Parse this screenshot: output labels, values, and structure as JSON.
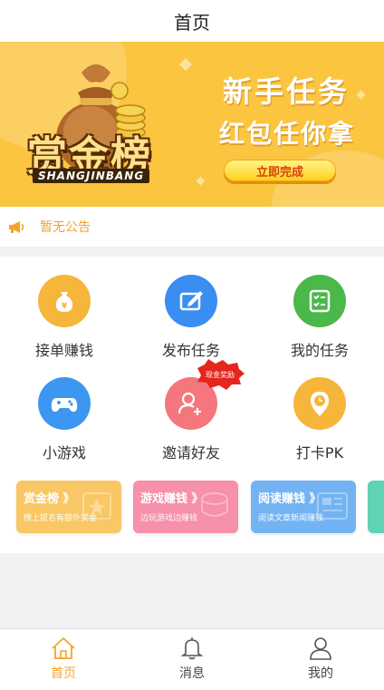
{
  "header": {
    "title": "首页"
  },
  "banner": {
    "logo_text": "赏金榜",
    "logo_subtext": "SHANGJINBANG",
    "slogan_line1": "新手任务",
    "slogan_line2": "红包任你拿",
    "cta_label": "立即完成"
  },
  "notice": {
    "icon": "megaphone-icon",
    "text": "暂无公告"
  },
  "grid": {
    "items": [
      {
        "label": "接单赚钱",
        "icon": "money-bag-icon",
        "color": "#f6b53b"
      },
      {
        "label": "发布任务",
        "icon": "edit-icon",
        "color": "#3a8df1"
      },
      {
        "label": "我的任务",
        "icon": "task-list-icon",
        "color": "#4bb84a"
      },
      {
        "label": "小游戏",
        "icon": "gamepad-icon",
        "color": "#3d96f0"
      },
      {
        "label": "邀请好友",
        "icon": "add-user-icon",
        "color": "#f3777d",
        "badge": "现金奖励"
      },
      {
        "label": "打卡PK",
        "icon": "location-clock-icon",
        "color": "#f6b53b"
      }
    ]
  },
  "cards": [
    {
      "title": "赏金榜 》",
      "subtitle": "榜上提名有额外奖金",
      "color": "#f9c765",
      "icon": "star-icon"
    },
    {
      "title": "游戏赚钱 》",
      "subtitle": "边玩游戏边赚钱",
      "color": "#f690ab",
      "icon": "coins-icon"
    },
    {
      "title": "阅读赚钱 》",
      "subtitle": "阅读文章新闻赚钱",
      "color": "#74b3f3",
      "icon": "newspaper-icon"
    },
    {
      "title": "",
      "subtitle": "",
      "color": "#5fd3b4",
      "icon": ""
    }
  ],
  "tabbar": {
    "active_color": "#f4a62a",
    "items": [
      {
        "label": "首页",
        "icon": "home-icon",
        "active": true
      },
      {
        "label": "消息",
        "icon": "bell-icon",
        "active": false
      },
      {
        "label": "我的",
        "icon": "user-icon",
        "active": false
      }
    ]
  }
}
